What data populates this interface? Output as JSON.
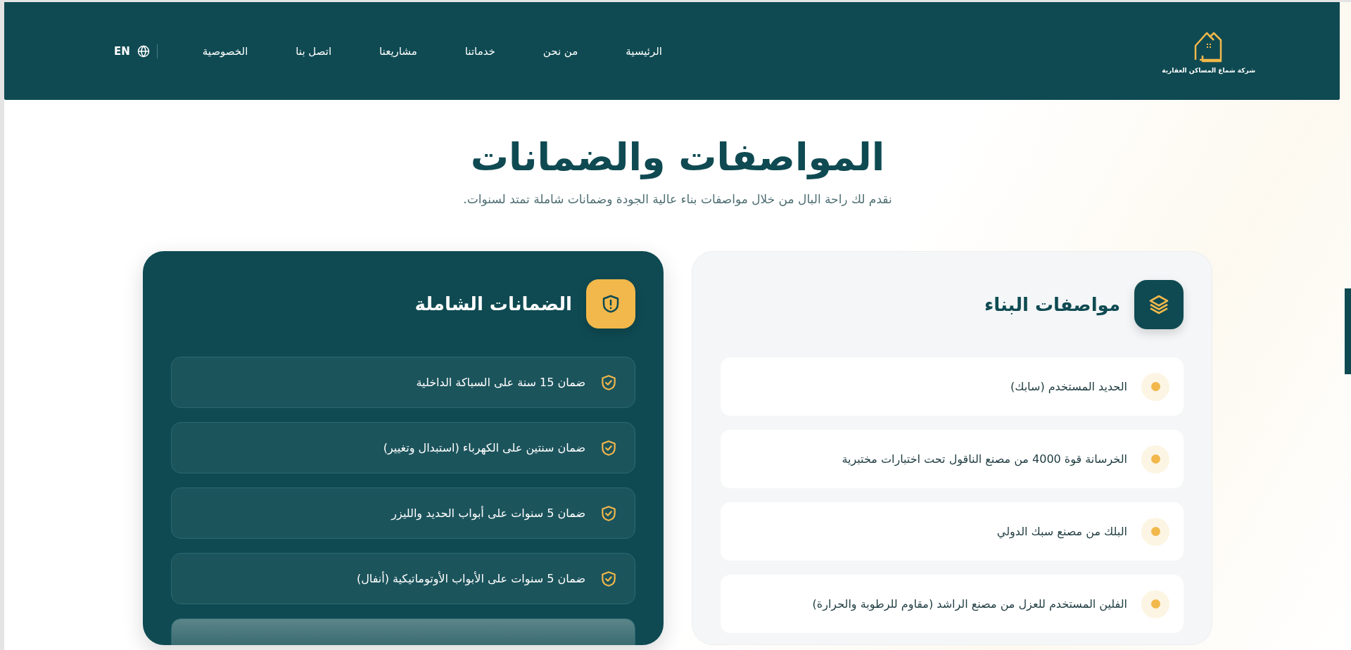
{
  "header": {
    "logo_text": "شركة شماع المساكن العقارية",
    "nav": [
      {
        "label": "الرئيسية"
      },
      {
        "label": "من نحن"
      },
      {
        "label": "خدماتنا"
      },
      {
        "label": "مشاريعنا"
      },
      {
        "label": "اتصل بنا"
      },
      {
        "label": "الخصوصية"
      }
    ],
    "language": "EN"
  },
  "hero": {
    "title": "المواصفات والضمانات",
    "subtitle": "نقدم لك راحة البال من خلال مواصفات بناء عالية الجودة وضمانات شاملة تمتد لسنوات."
  },
  "specs": {
    "title": "مواصفات البناء",
    "items": [
      {
        "text": "الحديد المستخدم (سابك)"
      },
      {
        "text": "الخرسانة قوة 4000 من مصنع الناقول تحت اختبارات مختبرية"
      },
      {
        "text": "البلك من مصنع سبك الدولي"
      },
      {
        "text": "الفلين المستخدم للعزل من مصنع الراشد (مقاوم للرطوبة والحرارة)"
      }
    ]
  },
  "guarantees": {
    "title": "الضمانات الشاملة",
    "items": [
      {
        "text": "ضمان 15 سنة على السباكة الداخلية"
      },
      {
        "text": "ضمان سنتين على الكهرباء (استبدال وتغيير)"
      },
      {
        "text": "ضمان 5 سنوات على أبواب الحديد والليزر"
      },
      {
        "text": "ضمان 5 سنوات على الأبواب الأوتوماتيكية (أنفال)"
      }
    ]
  }
}
